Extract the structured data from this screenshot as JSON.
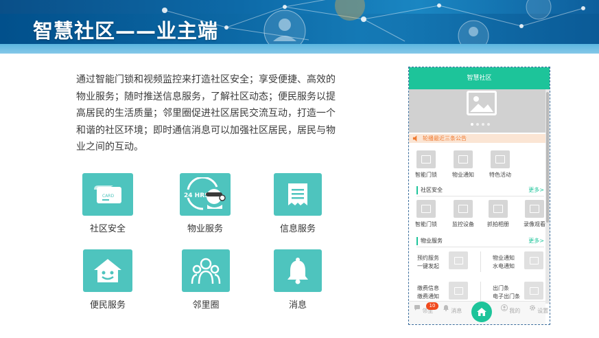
{
  "banner": {
    "title": "智慧社区——业主端"
  },
  "description": "通过智能门锁和视频监控来打造社区安全；享受便捷、高效的物业服务；随时推送信息服务，了解社区动态；便民服务以提高居民的生活质量；邻里圈促进社区居民交流互动，打造一个和谐的社区环境；即时通信消息可以加强社区居民，居民与物业之间的互动。",
  "features": [
    {
      "label": "社区安全",
      "icon": "card-icon"
    },
    {
      "label": "物业服务",
      "icon": "24hrs-service-icon"
    },
    {
      "label": "信息服务",
      "icon": "receipt-icon"
    },
    {
      "label": "便民服务",
      "icon": "smiling-house-icon"
    },
    {
      "label": "邻里圈",
      "icon": "people-group-icon"
    },
    {
      "label": "消息",
      "icon": "bell-icon"
    }
  ],
  "feature_card_text": {
    "card": "CARD",
    "hrs": "24 HRS"
  },
  "phone": {
    "header_title": "智慧社区",
    "notice": "轮播最近三条公告",
    "quick_items": [
      "智能门锁",
      "物业通知",
      "特色活动"
    ],
    "security": {
      "title": "社区安全",
      "more": "更多>",
      "items": [
        "智能门锁",
        "监控设备",
        "抓拍相册",
        "录像观看"
      ]
    },
    "property": {
      "title": "物业服务",
      "more": "更多>",
      "items": [
        {
          "title": "预约服务",
          "subtitle": "一键发起"
        },
        {
          "title": "物业通知",
          "subtitle": "水电通知"
        },
        {
          "title": "缴费信息",
          "subtitle": "缴费通知"
        },
        {
          "title": "出门条",
          "subtitle": "电子出门条"
        }
      ]
    },
    "tabbar": {
      "badge": "10",
      "tabs": [
        "邻里",
        "消息",
        "我的",
        "设置"
      ]
    }
  },
  "colors": {
    "accent_green": "#1dc49a",
    "tile_teal": "#4ec4be",
    "notice_orange": "#f07a30",
    "badge_red": "#f04a1e"
  }
}
